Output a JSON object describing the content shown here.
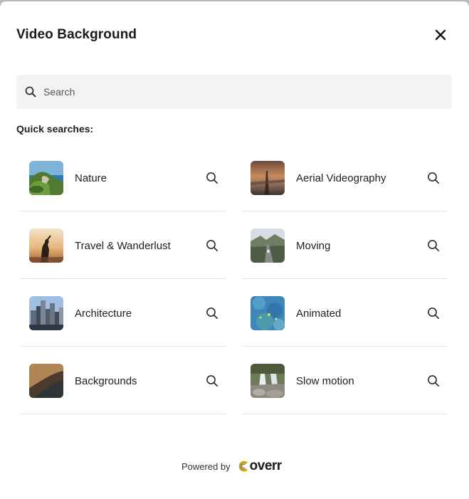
{
  "modal": {
    "title": "Video Background",
    "close_icon": "close-icon"
  },
  "search": {
    "placeholder": "Search",
    "value": "",
    "icon": "search-icon"
  },
  "quick": {
    "label": "Quick searches:",
    "items": [
      {
        "label": "Nature",
        "thumb": "nature"
      },
      {
        "label": "Aerial Videography",
        "thumb": "aerial"
      },
      {
        "label": "Travel & Wanderlust",
        "thumb": "travel"
      },
      {
        "label": "Moving",
        "thumb": "moving"
      },
      {
        "label": "Architecture",
        "thumb": "architecture"
      },
      {
        "label": "Animated",
        "thumb": "animated"
      },
      {
        "label": "Backgrounds",
        "thumb": "backgrounds"
      },
      {
        "label": "Slow motion",
        "thumb": "slowmotion"
      }
    ]
  },
  "footer": {
    "powered_by": "Powered by",
    "logo_text": "overr",
    "logo_letter": "c"
  },
  "colors": {
    "modal_bg": "#ffffff",
    "search_bg": "#f2f3f5",
    "divider": "#e4e4e4",
    "logo_orange": "#f0a500",
    "logo_green": "#4caf50",
    "logo_red": "#e53935"
  }
}
